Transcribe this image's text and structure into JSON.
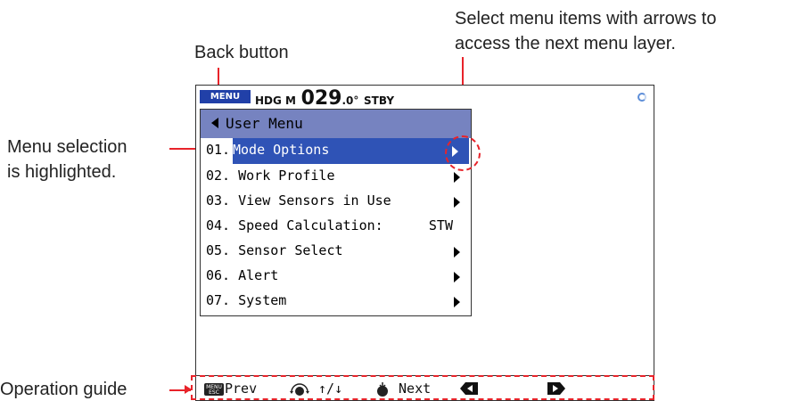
{
  "callouts": {
    "select_line1": "Select menu items with arrows to",
    "select_line2": "access the next menu layer.",
    "back_button": "Back button",
    "menu_selection_line1": "Menu selection",
    "menu_selection_line2": "is highlighted.",
    "operation_guide": "Operation guide"
  },
  "header": {
    "menu_badge": "MENU",
    "hdg_label": "HDG M",
    "hdg_value": "029",
    "hdg_decimal": ".0°",
    "mode": "STBY"
  },
  "menu": {
    "title": "User Menu",
    "items": [
      {
        "num": "01.",
        "label": "Mode Options",
        "value": "",
        "arrow": true,
        "selected": true
      },
      {
        "num": "02.",
        "label": "Work Profile",
        "value": "",
        "arrow": true,
        "selected": false
      },
      {
        "num": "03.",
        "label": "View Sensors in Use",
        "value": "",
        "arrow": true,
        "selected": false
      },
      {
        "num": "04.",
        "label": "Speed Calculation:",
        "value": "STW",
        "arrow": false,
        "selected": false
      },
      {
        "num": "05.",
        "label": "Sensor Select",
        "value": "",
        "arrow": true,
        "selected": false
      },
      {
        "num": "06.",
        "label": "Alert",
        "value": "",
        "arrow": true,
        "selected": false
      },
      {
        "num": "07.",
        "label": "System",
        "value": "",
        "arrow": true,
        "selected": false
      }
    ]
  },
  "footer": {
    "prev_label": "Prev",
    "updown_label": "↑/↓",
    "next_label": "Next",
    "menu_esc_icon": "menu-esc-key-icon",
    "knob_icon": "rotary-knob-icon",
    "push_icon": "knob-push-icon",
    "left_icon": "left-arrow-key-icon",
    "right_icon": "right-arrow-key-icon"
  },
  "colors": {
    "callout_red": "#e8232a",
    "title_bar": "#7683c0",
    "selection": "#2f53b6",
    "menu_badge": "#2140a8"
  }
}
